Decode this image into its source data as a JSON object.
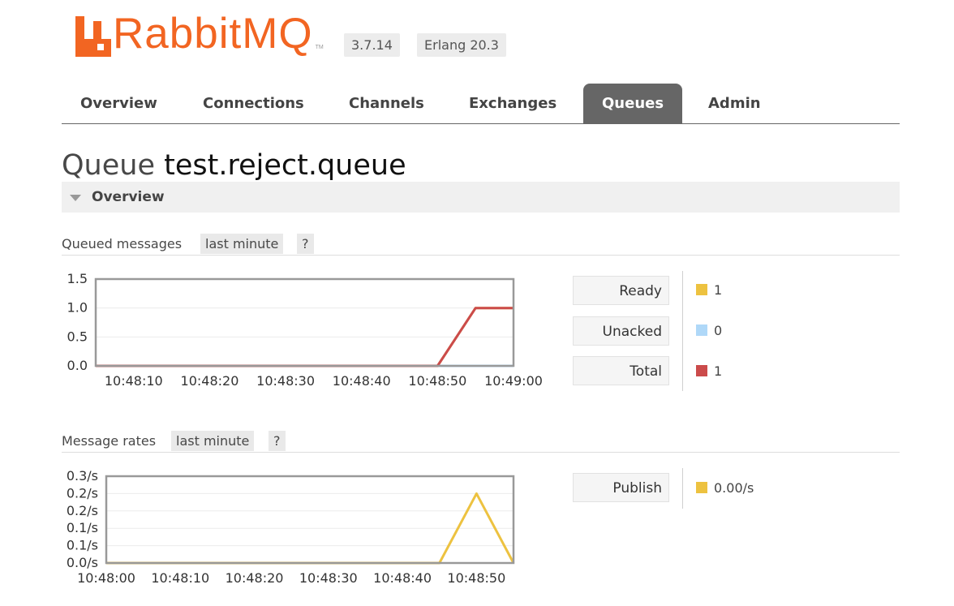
{
  "header": {
    "logo_text": "RabbitMQ",
    "logo_tm": "TM",
    "logo_icon": "rabbitmq-logo-icon",
    "version": "3.7.14",
    "erlang": "Erlang 20.3"
  },
  "nav": {
    "tabs": [
      {
        "label": "Overview"
      },
      {
        "label": "Connections"
      },
      {
        "label": "Channels"
      },
      {
        "label": "Exchanges"
      },
      {
        "label": "Queues",
        "active": true
      },
      {
        "label": "Admin"
      }
    ]
  },
  "page": {
    "title_prefix": "Queue",
    "queue_name": "test.reject.queue"
  },
  "section": {
    "label": "Overview",
    "icon": "triangle-down-icon"
  },
  "queued_messages": {
    "title": "Queued messages",
    "range": "last minute",
    "help": "?",
    "legend": [
      {
        "label": "Ready",
        "value": "1",
        "color": "#edc240"
      },
      {
        "label": "Unacked",
        "value": "0",
        "color": "#afd8f8"
      },
      {
        "label": "Total",
        "value": "1",
        "color": "#cb4b4b"
      }
    ]
  },
  "message_rates": {
    "title": "Message rates",
    "range": "last minute",
    "help": "?",
    "legend": [
      {
        "label": "Publish",
        "value": "0.00/s",
        "color": "#edc240"
      }
    ]
  },
  "chart_data": [
    {
      "type": "line",
      "title": "Queued messages",
      "y_ticks": [
        "1.5",
        "1.0",
        "0.5",
        "0.0"
      ],
      "ylim": [
        0,
        1.5
      ],
      "x_ticks": [
        "10:48:10",
        "10:48:20",
        "10:48:30",
        "10:48:40",
        "10:48:50",
        "10:49:00"
      ],
      "xlim": [
        "10:48:05",
        "10:49:00"
      ],
      "grid": true,
      "series": [
        {
          "name": "Unacked",
          "color": "#afd8f8",
          "points": [
            [
              "10:48:05",
              0
            ],
            [
              "10:48:50",
              0
            ],
            [
              "10:49:00",
              0
            ]
          ]
        },
        {
          "name": "Ready",
          "color": "#edc240",
          "points": [
            [
              "10:48:05",
              0
            ],
            [
              "10:48:50",
              0
            ],
            [
              "10:48:55",
              1
            ],
            [
              "10:49:00",
              1
            ]
          ]
        },
        {
          "name": "Total",
          "color": "#cb4b4b",
          "points": [
            [
              "10:48:05",
              0
            ],
            [
              "10:48:50",
              0
            ],
            [
              "10:48:55",
              1
            ],
            [
              "10:49:00",
              1
            ]
          ]
        }
      ]
    },
    {
      "type": "line",
      "title": "Message rates",
      "y_ticks": [
        "0.3/s",
        "0.2/s",
        "0.2/s",
        "0.1/s",
        "0.1/s",
        "0.0/s"
      ],
      "ylim": [
        0,
        0.25
      ],
      "x_ticks": [
        "10:48:00",
        "10:48:10",
        "10:48:20",
        "10:48:30",
        "10:48:40",
        "10:48:50"
      ],
      "xlim": [
        "10:48:00",
        "10:48:55"
      ],
      "grid": true,
      "series": [
        {
          "name": "Publish",
          "color": "#edc240",
          "points": [
            [
              "10:48:00",
              0
            ],
            [
              "10:48:45",
              0
            ],
            [
              "10:48:50",
              0.2
            ],
            [
              "10:48:55",
              0
            ]
          ]
        }
      ]
    }
  ]
}
